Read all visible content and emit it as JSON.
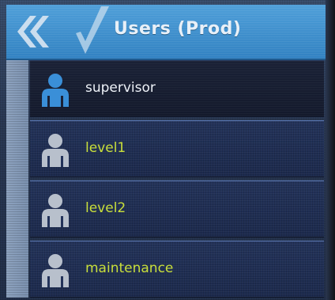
{
  "header": {
    "title": "Users (Prod)",
    "back_icon": "double-chevron-left-icon",
    "check_icon": "checkmark-icon"
  },
  "users": {
    "items": [
      {
        "label": "supervisor",
        "icon": "user-icon",
        "selected": true
      },
      {
        "label": "level1",
        "icon": "user-icon",
        "selected": false
      },
      {
        "label": "level2",
        "icon": "user-icon",
        "selected": false
      },
      {
        "label": "maintenance",
        "icon": "user-icon",
        "selected": false
      }
    ]
  },
  "colors": {
    "header_blue": "#3f8fcc",
    "item_text_green": "#c9df3a",
    "selected_text": "#eef2f8",
    "selected_icon": "#3a8fd8",
    "unselected_icon": "#b8c0cc"
  }
}
